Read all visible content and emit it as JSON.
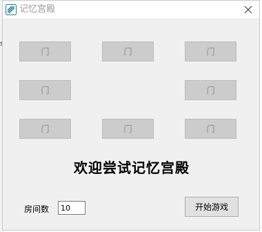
{
  "window": {
    "title": "记忆宫殿"
  },
  "doors": {
    "label": "门",
    "state": "disabled"
  },
  "welcome_text": "欢迎尝试记忆宫殿",
  "room_count": {
    "label": "房间数",
    "value": "10"
  },
  "start_button": {
    "label": "开始游戏"
  },
  "colors": {
    "window_bg": "#f0f0f0",
    "door_bg": "#cccccc",
    "door_text": "#8a8a8a",
    "title_text": "#9a9a9a"
  },
  "icons": {
    "app": "app-logo-icon",
    "close": "close-icon"
  }
}
